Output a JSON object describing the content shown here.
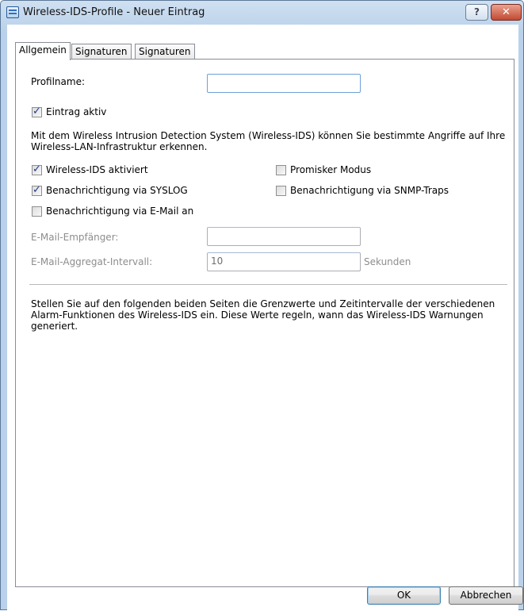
{
  "window": {
    "title": "Wireless-IDS-Profile - Neuer Eintrag",
    "help_label": "?",
    "close_label": "✕",
    "title_icon": "window-list-icon"
  },
  "tabs": [
    {
      "label": "Allgemein",
      "active": true
    },
    {
      "label": "Signaturen",
      "active": false
    },
    {
      "label": "Signaturen",
      "active": false
    }
  ],
  "form": {
    "profile_name_label": "Profilname:",
    "profile_name_value": "",
    "entry_active_label": "Eintrag aktiv",
    "entry_active_checked": true,
    "intro_text": "Mit dem Wireless Intrusion Detection System (Wireless-IDS) können Sie bestimmte Angriffe auf Ihre Wireless-LAN-Infrastruktur erkennen.",
    "options": {
      "ids_enabled": {
        "label": "Wireless-IDS aktiviert",
        "checked": true
      },
      "promiscuous": {
        "label": "Promisker Modus",
        "checked": false
      },
      "notify_syslog": {
        "label": "Benachrichtigung via SYSLOG",
        "checked": true
      },
      "notify_snmp": {
        "label": "Benachrichtigung via SNMP-Traps",
        "checked": false
      },
      "notify_email": {
        "label": "Benachrichtigung via E-Mail an",
        "checked": false
      }
    },
    "email_recipient_label": "E-Mail-Empfänger:",
    "email_recipient_value": "",
    "email_interval_label": "E-Mail-Aggregat-Intervall:",
    "email_interval_value": "10",
    "email_interval_unit": "Sekunden",
    "footer_text": "Stellen Sie auf den folgenden beiden Seiten die Grenzwerte und Zeitintervalle der verschiedenen Alarm-Funktionen des Wireless-IDS ein. Diese Werte regeln, wann das Wireless-IDS Warnungen generiert."
  },
  "buttons": {
    "ok": "OK",
    "cancel": "Abbrechen"
  }
}
